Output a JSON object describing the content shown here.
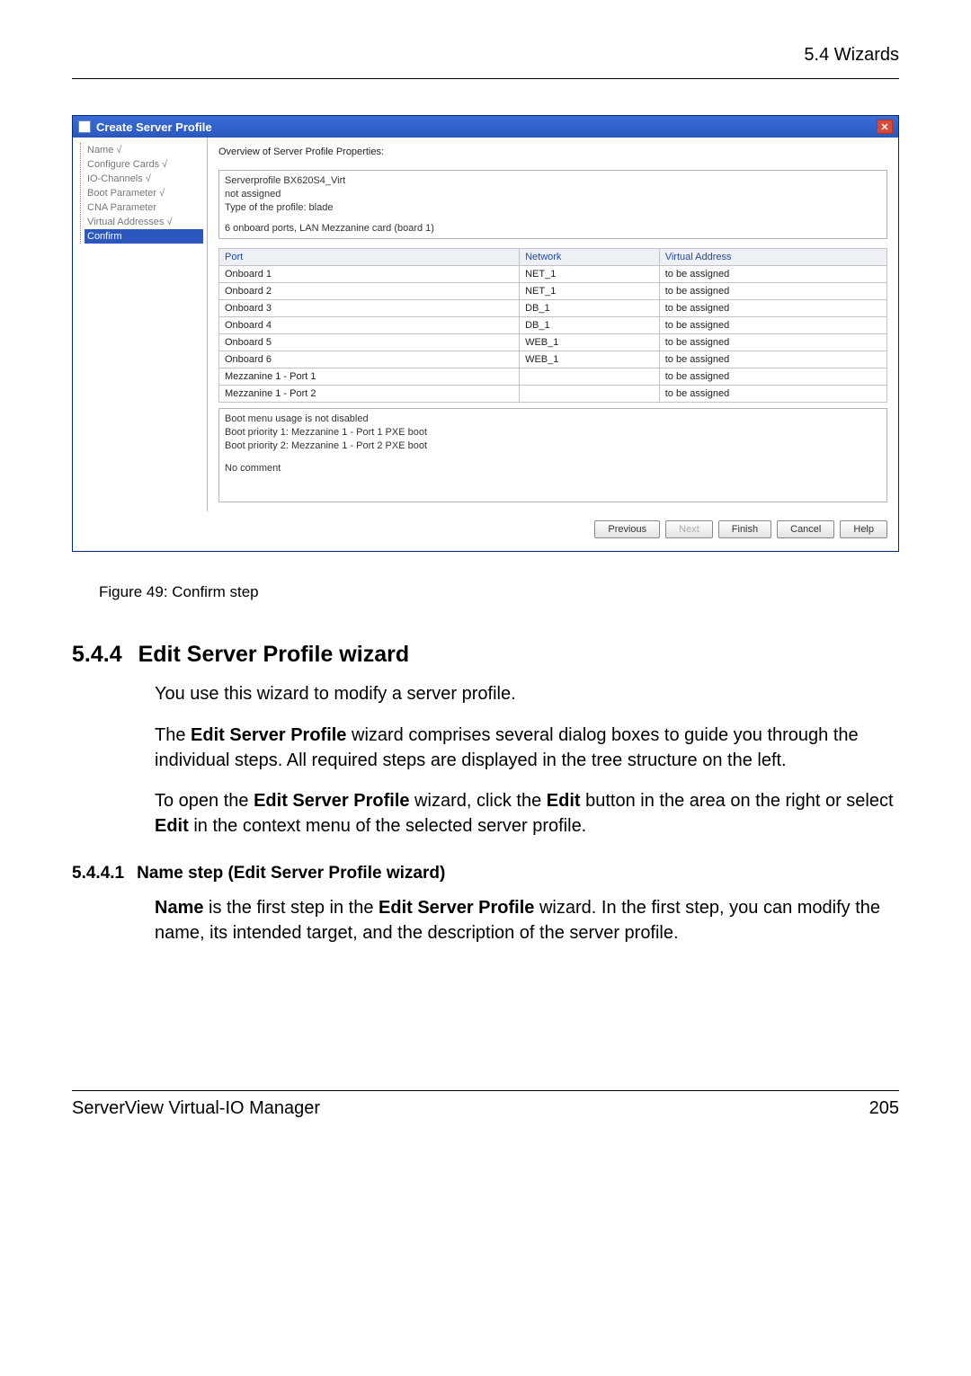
{
  "header": {
    "section_ref": "5.4 Wizards"
  },
  "dialog": {
    "title": "Create Server Profile",
    "tree": [
      {
        "label": "Name √",
        "active": false
      },
      {
        "label": "Configure Cards √",
        "active": false
      },
      {
        "label": "IO-Channels √",
        "active": false
      },
      {
        "label": "Boot Parameter √",
        "active": false
      },
      {
        "label": "CNA Parameter",
        "active": false
      },
      {
        "label": "Virtual Addresses √",
        "active": false
      },
      {
        "label": "Confirm",
        "active": true
      }
    ],
    "overview_label": "Overview of Server Profile Properties:",
    "summary": {
      "line1": "Serverprofile BX620S4_Virt",
      "line2": "not assigned",
      "line3": "Type of the profile: blade",
      "line4": "6 onboard ports, LAN Mezzanine card (board 1)"
    },
    "table": {
      "headers": {
        "port": "Port",
        "network": "Network",
        "addr": "Virtual Address"
      },
      "rows": [
        {
          "port": "Onboard 1",
          "network": "NET_1",
          "addr": "to be assigned"
        },
        {
          "port": "Onboard 2",
          "network": "NET_1",
          "addr": "to be assigned"
        },
        {
          "port": "Onboard 3",
          "network": "DB_1",
          "addr": "to be assigned"
        },
        {
          "port": "Onboard 4",
          "network": "DB_1",
          "addr": "to be assigned"
        },
        {
          "port": "Onboard 5",
          "network": "WEB_1",
          "addr": "to be assigned"
        },
        {
          "port": "Onboard 6",
          "network": "WEB_1",
          "addr": "to be assigned"
        },
        {
          "port": "Mezzanine 1 - Port 1",
          "network": "",
          "addr": "to be assigned"
        },
        {
          "port": "Mezzanine 1 - Port 2",
          "network": "",
          "addr": "to be assigned"
        }
      ]
    },
    "boot": {
      "line1": "Boot menu usage is not disabled",
      "line2": "Boot priority 1: Mezzanine 1 - Port 1   PXE boot",
      "line3": "Boot priority 2: Mezzanine 1 - Port 2   PXE boot",
      "line4": "No comment"
    },
    "buttons": {
      "previous": "Previous",
      "next": "Next",
      "finish": "Finish",
      "cancel": "Cancel",
      "help": "Help"
    }
  },
  "figure_caption": "Figure 49: Confirm step",
  "section544": {
    "num": "5.4.4",
    "title": "Edit Server Profile wizard",
    "p1": "You use this wizard to modify a server profile.",
    "p2_pre": "The ",
    "p2_bold1": "Edit Server Profile",
    "p2_post": " wizard comprises several dialog boxes to guide you through the individual steps. All required steps are displayed in the tree structure on the left.",
    "p3_a": "To open the ",
    "p3_bold1": "Edit Server Profile",
    "p3_b": " wizard, click the ",
    "p3_bold2": "Edit",
    "p3_c": " button in the area on the right or select ",
    "p3_bold3": "Edit",
    "p3_d": " in the context menu of the selected server profile."
  },
  "section5441": {
    "num": "5.4.4.1",
    "title": "Name step (Edit Server Profile wizard)",
    "p1_bold1": "Name",
    "p1_a": " is the first step in the ",
    "p1_bold2": "Edit Server Profile",
    "p1_b": " wizard. In the first step, you can modify the name, its intended target, and the description of the server profile."
  },
  "footer": {
    "left": "ServerView Virtual-IO Manager",
    "right": "205"
  }
}
